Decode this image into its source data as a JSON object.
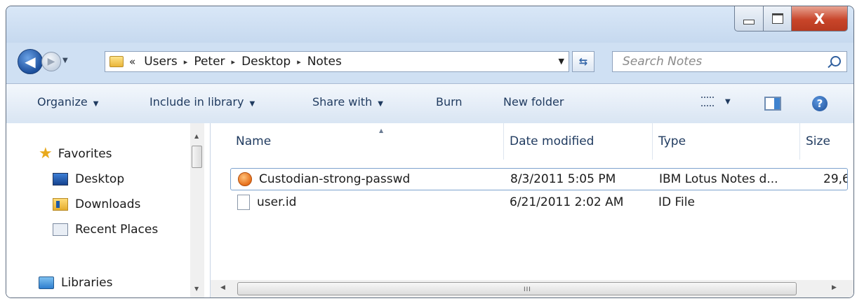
{
  "window": {
    "minimize_glyph": "",
    "maximize_glyph": "",
    "close_glyph": "X"
  },
  "navigation": {
    "back_glyph": "◀",
    "forward_glyph": "▶",
    "breadcrumb": {
      "chevron": "«",
      "separator": "▸",
      "items": [
        "Users",
        "Peter",
        "Desktop",
        "Notes"
      ]
    },
    "refresh_glyph": "⇆",
    "search_placeholder": "Search Notes"
  },
  "toolbar": {
    "organize": "Organize",
    "include_in_library": "Include in library",
    "share_with": "Share with",
    "burn": "Burn",
    "new_folder": "New folder",
    "dropdown_caret": "▼",
    "help_glyph": "?"
  },
  "sidebar": {
    "favorites": {
      "label": "Favorites",
      "items": [
        "Desktop",
        "Downloads",
        "Recent Places"
      ]
    },
    "libraries": {
      "label": "Libraries"
    }
  },
  "file_list": {
    "columns": {
      "name": "Name",
      "date_modified": "Date modified",
      "type": "Type",
      "size": "Size"
    },
    "sort_indicator": "▲",
    "rows": [
      {
        "name": "Custodian-strong-passwd",
        "date_modified": "8/3/2011 5:05 PM",
        "type": "IBM Lotus Notes d...",
        "size": "29,6",
        "icon": "lotus-notes-database-icon",
        "selected": true
      },
      {
        "name": "user.id",
        "date_modified": "6/21/2011 2:02 AM",
        "type": "ID File",
        "size": "",
        "icon": "generic-file-icon",
        "selected": false
      }
    ]
  },
  "scrollbar": {
    "grip": "III"
  },
  "colors": {
    "window_frame": "#cfe0f3",
    "toolbar_text": "#1f3a5f",
    "close_button": "#c8452a",
    "selection_border": "#7da2ce"
  }
}
